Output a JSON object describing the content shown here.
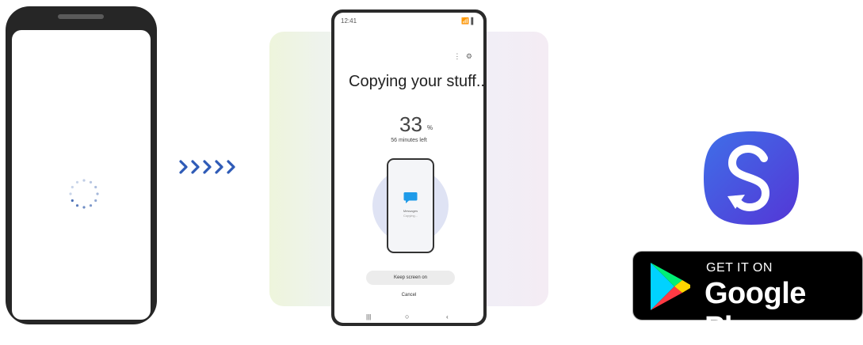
{
  "left_phone": {
    "spinner_icon": "loading-spinner-icon"
  },
  "arrows": {
    "icon": "chevrons-right-icon",
    "count": 5,
    "color": "#2f5bb7"
  },
  "center_phone": {
    "status_time": "12:41",
    "status_icons": "📶 ▌",
    "title": "Copying your stuff...",
    "percent": "33",
    "percent_symbol": "%",
    "time_left": "56 minutes left",
    "current_item_label": "Messages",
    "current_item_sub": "Copying...",
    "keep_screen_on_label": "Keep screen on",
    "cancel_label": "Cancel",
    "nav_back": "|||",
    "nav_home": "○",
    "nav_recent": "‹"
  },
  "app": {
    "icon": "smart-switch-app-icon",
    "icon_color": "#4b3fe0"
  },
  "store_badge": {
    "top_text": "GET IT ON",
    "main_text": "Google Play",
    "icon": "google-play-logo-icon"
  }
}
